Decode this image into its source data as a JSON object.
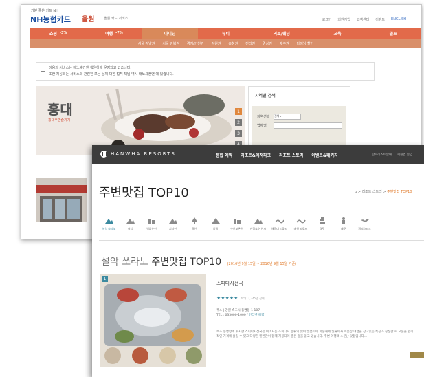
{
  "back_window": {
    "brand_small": "기분 좋은 카드 NH",
    "brand": "NH농협카드",
    "service_logo": "올원",
    "service_sub": "올원 카드 서비스",
    "top_links": [
      "로그인",
      "회원가입",
      "고객센터",
      "이벤트",
      "ENGLISH"
    ],
    "nav_main": [
      {
        "label": "쇼핑",
        "badge": "-3%",
        "active": false
      },
      {
        "label": "여행",
        "badge": "-7%",
        "active": false
      },
      {
        "label": "다이닝",
        "badge": "",
        "active": true
      },
      {
        "label": "뷰티",
        "badge": "",
        "active": false
      },
      {
        "label": "의료/웨딩",
        "badge": "",
        "active": false
      },
      {
        "label": "교육",
        "badge": "",
        "active": false
      },
      {
        "label": "골프",
        "badge": "",
        "active": false
      }
    ],
    "nav_sub": [
      "서울 강남권",
      "서울 강북권",
      "경기/인천권",
      "강원권",
      "충청권",
      "전라권",
      "경상권",
      "제주권",
      "다이닝 할인"
    ],
    "notice_line1": "이용의 서비스는 배노셰칸앤 책임하에 운영되고 있습니다.",
    "notice_line2": "또한 제공되는 서비스와 관련된 모든 문제 대한 법적 책임 역시 배노셰칸앤 에 있습니다.",
    "hero_title": "홍대",
    "hero_subtitle": "홍대주변즐기기",
    "hero_pages": [
      "1",
      "2",
      "3",
      "4"
    ],
    "region_search": {
      "title": "지역별 검색",
      "label_area": "지역선택",
      "select_value": "전체",
      "label_keyword": "업체명",
      "button": "검색"
    }
  },
  "front_window": {
    "logo_text": "HANWHA RESORTS",
    "menu": [
      "통합 예약",
      "리조트&레저파크",
      "리조트 스토리",
      "이벤트&패키지"
    ],
    "util_links": [
      "한화리조트안내",
      "회원권 분양"
    ],
    "page_title": "주변맛집 TOP10",
    "breadcrumb_prefix": "⌂ > 리조트 스토리 >",
    "breadcrumb_current": "주변맛집 TOP10",
    "resort_tabs": [
      {
        "label": "설악 쏘라노",
        "icon": "mountain-icon",
        "active": true
      },
      {
        "label": "설악",
        "icon": "mountain-icon",
        "active": false
      },
      {
        "label": "백암온천",
        "icon": "building-icon",
        "active": false
      },
      {
        "label": "지리산",
        "icon": "mountain-icon",
        "active": false
      },
      {
        "label": "용인",
        "icon": "tree-icon",
        "active": false
      },
      {
        "label": "양평",
        "icon": "tent-icon",
        "active": false
      },
      {
        "label": "수안보온천",
        "icon": "building-icon",
        "active": false
      },
      {
        "label": "산정호수 안시",
        "icon": "mountain-icon",
        "active": false
      },
      {
        "label": "해운대 티볼리",
        "icon": "wave-icon",
        "active": false
      },
      {
        "label": "대천 파로스",
        "icon": "wave-icon",
        "active": false
      },
      {
        "label": "경주",
        "icon": "pagoda-icon",
        "active": false
      },
      {
        "label": "제주",
        "icon": "statue-icon",
        "active": false
      },
      {
        "label": "휘닉스파크",
        "icon": "bird-icon",
        "active": false
      }
    ],
    "section_title_prefix": "설악 쏘라노",
    "section_title_main": "주변맛집 TOP10",
    "section_period": "(2016년 9월 15일 ~ 2016년 9월 15일 기준)",
    "restaurant": {
      "rank": "1",
      "name": "스피다시전국",
      "stars": "★★★★★",
      "rating": "4.5(12,345명 참여)",
      "address": "주소 | 강원 속초시 동명동 1-107",
      "tel": "TEL : 033000-1000 / ",
      "tel_link": "인터넷 예약",
      "description": "속초 동명항에 위치한 스피다시전국은 이어지는 스피다시 종류의 맛이 일품이며 외중해세 일류이자 최문상 여행을 상고있는 특징가 싱싱한 회 모둠을 합리적인 가격에 즐길 수 있고 다양한 밑반찬이 함께 제공되어 좋은 평을 얻고 있습니다. 주변 어행객 소문난 맛집입니다..."
    }
  }
}
